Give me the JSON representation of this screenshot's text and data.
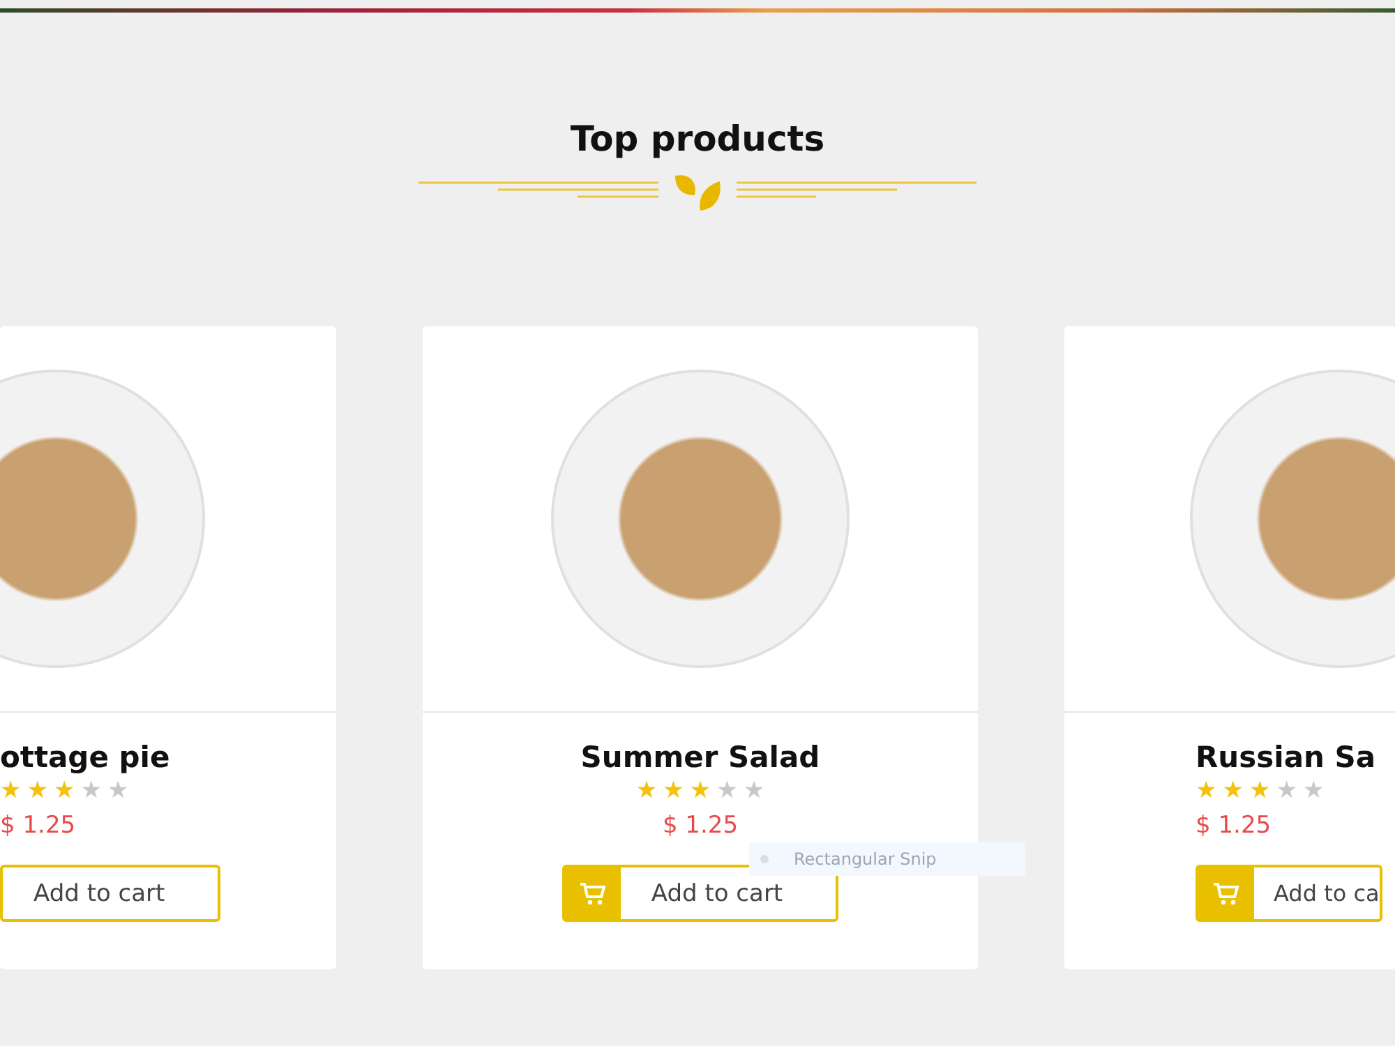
{
  "section": {
    "title": "Top products"
  },
  "products": [
    {
      "kind": "left-edge",
      "name": "ottage pie",
      "stars": 3,
      "price": "$ 1.25",
      "button": "Add to cart"
    },
    {
      "kind": "full",
      "name": "Summer Salad",
      "stars": 3,
      "price": "$ 1.25",
      "button": "Add to cart"
    },
    {
      "kind": "right-edge",
      "name": "Russian Sa",
      "stars": 3,
      "price": "$ 1.25",
      "button": "Add to ca"
    }
  ],
  "overlay": {
    "label": "Rectangular Snip"
  }
}
